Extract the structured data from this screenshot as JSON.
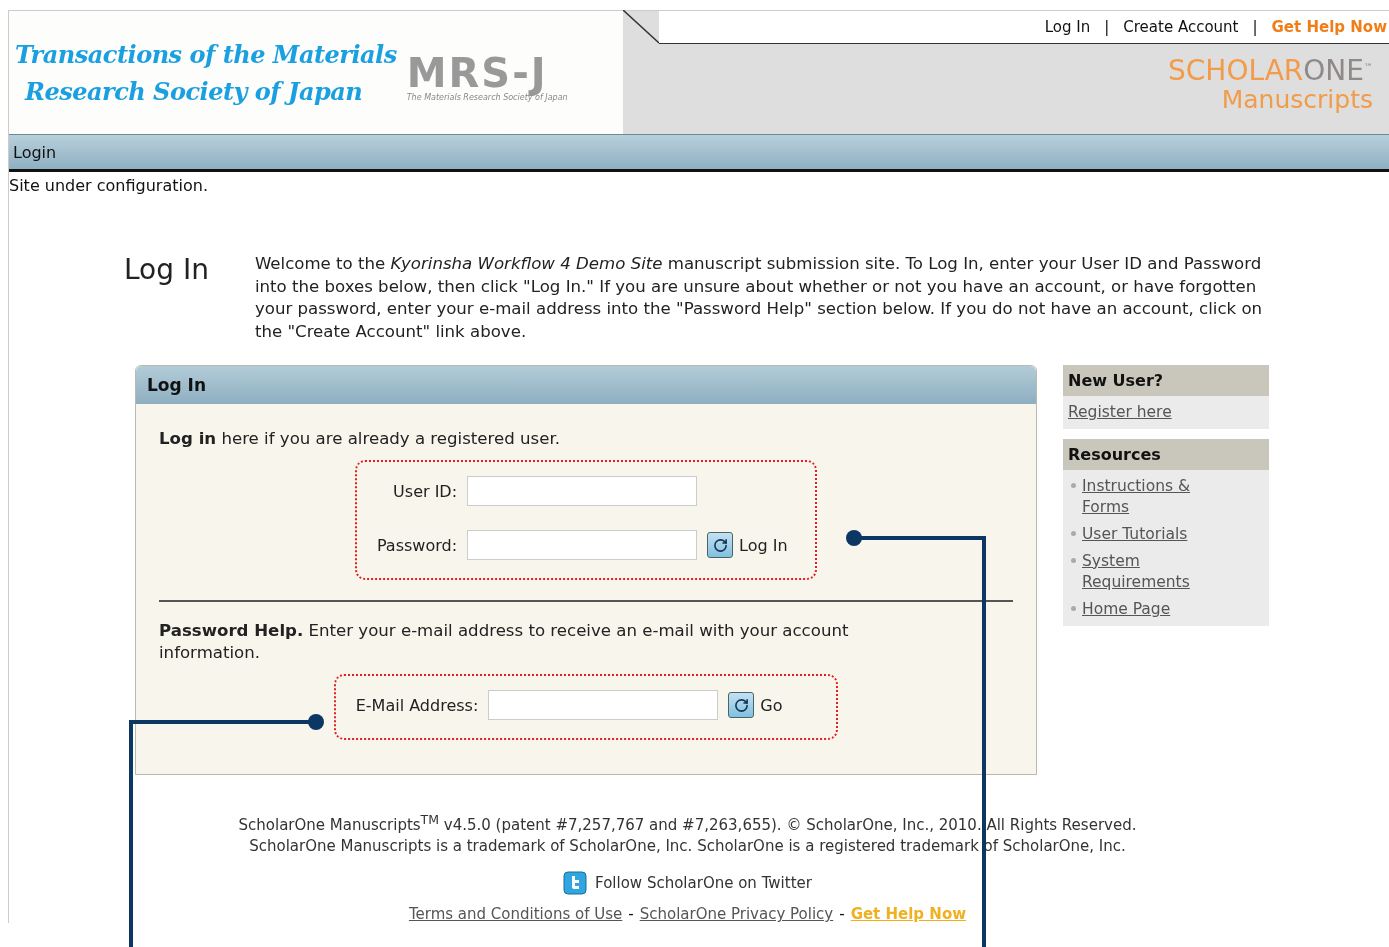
{
  "header": {
    "journal_title": [
      "Transactions of the Materials",
      "Research Society of Japan"
    ],
    "logo_text": "MRS-J",
    "logo_subtitle": "The Materials Research Society of Japan",
    "top_separator": "|",
    "top_links": [
      {
        "label": "Log In",
        "kind": "link"
      },
      {
        "label": "Create Account",
        "kind": "link"
      },
      {
        "label": "Get Help Now",
        "kind": "help"
      }
    ],
    "brand": {
      "first": "SCHOLAR",
      "second": "ONE",
      "tm": "™",
      "product": "Manuscripts"
    }
  },
  "breadcrumb": "Login",
  "notice": "Site under configuration.",
  "page_heading": "Log In",
  "intro": "Welcome to the *Kyorinsha Workflow 4 Demo Site* manuscript submission site. To Log In, enter your User ID and Password into the boxes below, then click \"Log In.\" If you are unsure about whether or not you have an account, or have forgotten your password, enter your e-mail address into the \"Password Help\" section below. If you do not have an account, click on the \"Create Account\" link above.",
  "login_panel": {
    "title": "Log In",
    "groups": [
      {
        "text": "**Log in** here if you are already a registered user.",
        "rows": [
          {
            "label": "User ID:"
          },
          {
            "label": "Password:",
            "button": "Log In"
          }
        ]
      },
      {
        "text": "**Password Help.** Enter your e-mail address to receive an e-mail with your account information.",
        "rows": [
          {
            "label": "E-Mail Address:",
            "button": "Go"
          }
        ]
      }
    ]
  },
  "sidebar": [
    {
      "title": "New User?",
      "kind": "plain",
      "links": [
        "Register here"
      ]
    },
    {
      "title": "Resources",
      "kind": "bulleted",
      "links": [
        "Instructions & Forms",
        "User Tutorials",
        "System Requirements",
        "Home Page"
      ]
    }
  ],
  "footer": {
    "copyright": "ScholarOne Manuscripts$^{TM}$ v4.5.0 (patent #7,257,767 and #7,263,655). © ScholarOne, Inc., 2010. All Rights Reserved.",
    "trademark": "ScholarOne Manuscripts is a trademark of ScholarOne, Inc. ScholarOne is a registered trademark of ScholarOne, Inc.",
    "twitter": "Follow ScholarOne on Twitter",
    "links": [
      {
        "label": "Terms and Conditions of Use",
        "kind": "link"
      },
      {
        "label": "ScholarOne Privacy Policy",
        "kind": "link"
      },
      {
        "label": "Get Help Now",
        "kind": "help"
      }
    ],
    "separator": "-"
  }
}
